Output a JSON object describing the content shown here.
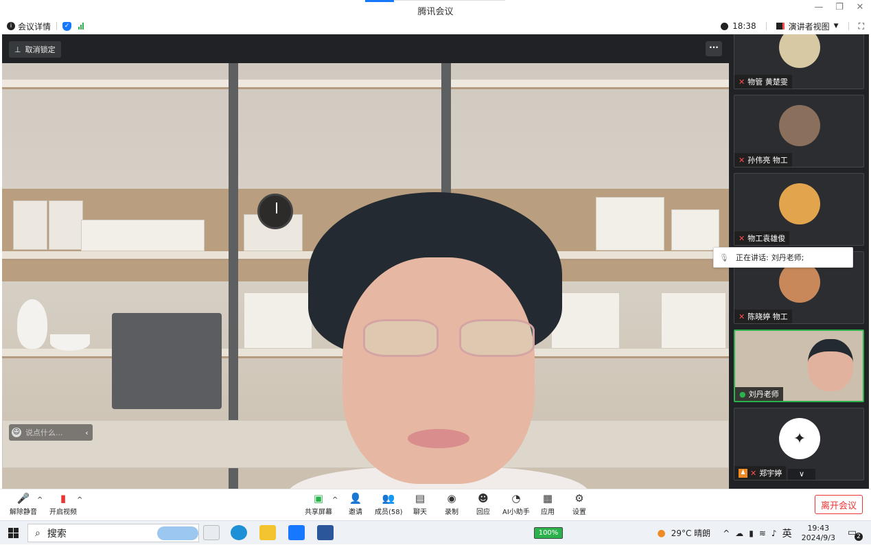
{
  "window": {
    "title": "腾讯会议",
    "controls": [
      "—",
      "❐",
      "✕"
    ]
  },
  "infobar": {
    "meeting_details": "会议详情",
    "time": "18:38",
    "view_mode": "演讲者视图"
  },
  "main_video": {
    "unlock_label": "取消锁定",
    "more": "···",
    "chat_placeholder": "说点什么..."
  },
  "participants": [
    {
      "name": "物管 黄楚雯",
      "avatar_color": "#d8c9a5"
    },
    {
      "name": "孙伟亮 物工",
      "avatar_color": "#8a6f5c"
    },
    {
      "name": "物工袁雄俊",
      "avatar_color": "#e2a54e"
    },
    {
      "name": "陈晓婷 物工",
      "avatar_color": "#c9885a"
    },
    {
      "name": "刘丹老师",
      "avatar_color": "#2bb24c"
    },
    {
      "name": "郑宇婷",
      "avatar_color": "#ffffff"
    }
  ],
  "speaking": {
    "label": "正在讲话:",
    "name": "刘丹老师;"
  },
  "toolbar": {
    "unmute": "解除静音",
    "start_video": "开启视频",
    "share": "共享屏幕",
    "invite": "邀请",
    "members": "成员(58)",
    "chat": "聊天",
    "record": "录制",
    "react": "回应",
    "ai": "AI小助手",
    "apps": "应用",
    "settings": "设置",
    "leave": "离开会议"
  },
  "taskbar": {
    "search": "搜索",
    "battery": "100%",
    "weather": "29°C 晴朗",
    "ime": "英",
    "clock_time": "19:43",
    "clock_date": "2024/9/3",
    "notif_count": "2"
  },
  "colors": {
    "accent": "#1677ff",
    "active": "#2bb24c",
    "danger": "#e33333"
  }
}
